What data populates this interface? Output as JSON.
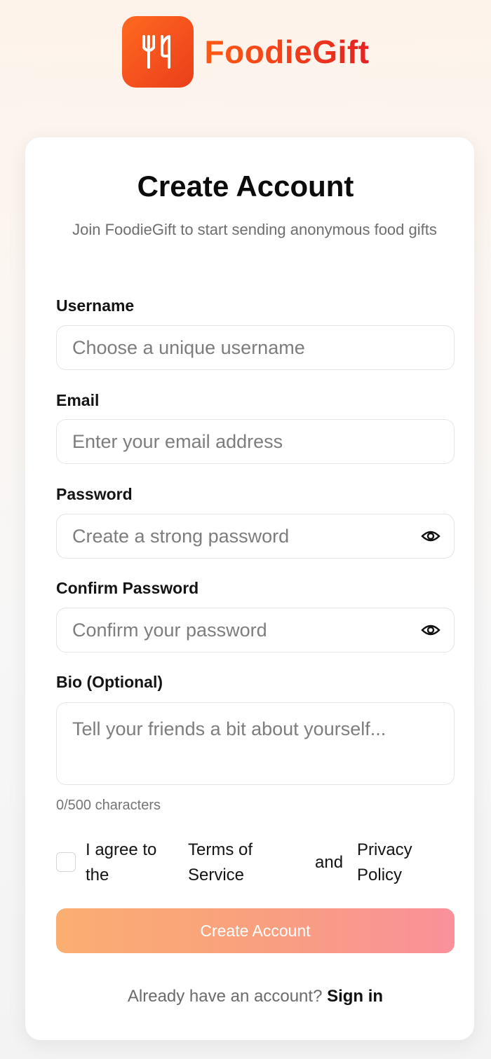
{
  "brand": {
    "name": "FoodieGift"
  },
  "card": {
    "title": "Create Account",
    "subtitle": "Join FoodieGift to start sending anonymous food gifts"
  },
  "fields": {
    "username": {
      "label": "Username",
      "placeholder": "Choose a unique username"
    },
    "email": {
      "label": "Email",
      "placeholder": "Enter your email address"
    },
    "password": {
      "label": "Password",
      "placeholder": "Create a strong password"
    },
    "confirm": {
      "label": "Confirm Password",
      "placeholder": "Confirm your password"
    },
    "bio": {
      "label": "Bio (Optional)",
      "placeholder": "Tell your friends a bit about yourself...",
      "counter": "0/500 characters"
    }
  },
  "agreement": {
    "part1_line1": "I agree to",
    "part1_line2": "the",
    "terms_line1": "Terms of",
    "terms_line2": "Service",
    "and": "and",
    "privacy_line1": "Privacy",
    "privacy_line2": "Policy",
    "checked": false
  },
  "submit": {
    "label": "Create Account"
  },
  "footer": {
    "prompt": "Already have an account?",
    "link": "Sign in"
  },
  "colors": {
    "brand": "#f4511e",
    "button_start": "#fbae72",
    "button_end": "#f9919a"
  },
  "icons": {
    "logo": "fork-knife-icon",
    "reveal": "eye-icon"
  }
}
